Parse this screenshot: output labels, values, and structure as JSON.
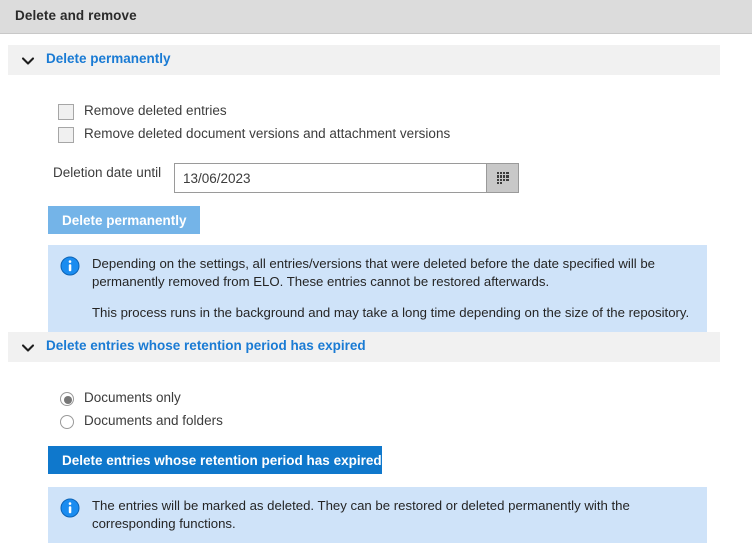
{
  "window": {
    "title": "Delete and remove"
  },
  "sections": [
    {
      "id": "delete-permanently",
      "header_label": "Delete permanently",
      "chevron_icon": "chevron-down-icon",
      "checkboxes": [
        {
          "label": "Remove deleted entries",
          "checked": false
        },
        {
          "label": "Remove deleted document versions and attachment versions",
          "checked": false
        }
      ],
      "date_field": {
        "label": "Deletion date until",
        "value": "13/06/2023",
        "placeholder": "DD/MM/YYYY",
        "picker_icon": "calendar-grid-icon"
      },
      "button": {
        "label": "Delete permanently",
        "color": "#74b4e8"
      },
      "info": {
        "icon": "info-circle-icon",
        "color": "#cfe3f9",
        "lines": [
          "Depending on the settings, all entries/versions that were deleted before the date specified will be permanently removed from ELO. These entries cannot be restored afterwards.",
          "This process runs in the background and may take a long time depending on the size of the repository."
        ]
      }
    },
    {
      "id": "delete-retention-expired",
      "header_label": "Delete entries whose retention period has expired",
      "chevron_icon": "chevron-down-icon",
      "radios": [
        {
          "label": "Documents only",
          "checked": true
        },
        {
          "label": "Documents and folders",
          "checked": false
        }
      ],
      "button": {
        "label": "Delete entries whose retention period has expired",
        "color": "#0f78cc"
      },
      "info": {
        "icon": "info-circle-icon",
        "color": "#cfe3f9",
        "lines": [
          "The entries will be marked as deleted. They can be restored or deleted permanently with the corresponding functions."
        ]
      }
    }
  ],
  "theme": {
    "accent_blue": "#1a7bd4",
    "titlebar_bg": "#dcdcdc",
    "section_header_bg": "#f1f1f1",
    "info_bg": "#cfe3f9"
  }
}
